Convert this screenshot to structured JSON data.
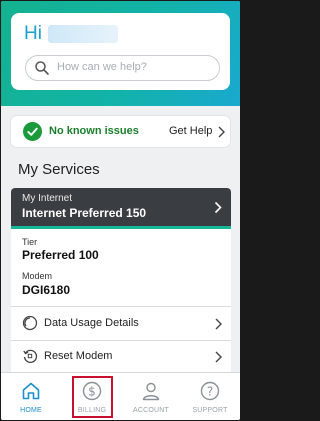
{
  "greeting": {
    "hi": "Hi"
  },
  "search": {
    "placeholder": "How can we help?"
  },
  "status": {
    "text": "No known issues",
    "help_label": "Get Help"
  },
  "services": {
    "title": "My Services",
    "internet": {
      "subtitle": "My Internet",
      "plan": "Internet Preferred 150",
      "tier_label": "Tier",
      "tier_value": "Preferred 100",
      "modem_label": "Modem",
      "modem_value": "DGI6180",
      "actions": [
        {
          "label": "Data Usage Details",
          "icon": "gauge-icon"
        },
        {
          "label": "Reset Modem",
          "icon": "reset-icon"
        }
      ]
    }
  },
  "tabs": [
    {
      "label": "HOME",
      "icon": "home-icon",
      "active": true
    },
    {
      "label": "BILLING",
      "icon": "dollar-icon",
      "active": false
    },
    {
      "label": "ACCOUNT",
      "icon": "person-icon",
      "active": false
    },
    {
      "label": "SUPPORT",
      "icon": "question-icon",
      "active": false
    }
  ],
  "colors": {
    "accent": "#1b8fcf",
    "status_green": "#1a7f2b",
    "header_dark": "#3a3d41",
    "highlight": "#c8102e"
  }
}
